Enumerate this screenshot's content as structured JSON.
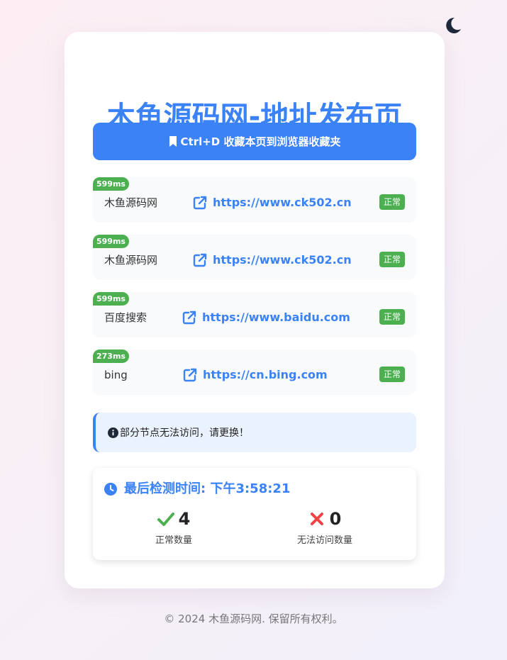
{
  "header": {
    "title": "木鱼源码网-地址发布页"
  },
  "bookmark_button": {
    "label": "Ctrl+D 收藏本页到浏览器收藏夹"
  },
  "links": [
    {
      "latency": "599ms",
      "name": "木鱼源码网",
      "url": "https://www.ck502.cn",
      "status": "正常"
    },
    {
      "latency": "599ms",
      "name": "木鱼源码网",
      "url": "https://www.ck502.cn",
      "status": "正常"
    },
    {
      "latency": "599ms",
      "name": "百度搜索",
      "url": "https://www.baidu.com",
      "status": "正常"
    },
    {
      "latency": "273ms",
      "name": "bing",
      "url": "https://cn.bing.com",
      "status": "正常"
    }
  ],
  "notice": {
    "text": "部分节点无法访问，请更换！"
  },
  "check": {
    "title": "最后检测时间: 下午3:58:21",
    "ok_count": "4",
    "ok_label": "正常数量",
    "fail_count": "0",
    "fail_label": "无法访问数量"
  },
  "footer": {
    "text": "© 2024 木鱼源码网. 保留所有权利。"
  },
  "colors": {
    "accent": "#3b82f6",
    "success": "#4caf50",
    "danger": "#ef4444",
    "moon": "#1e293b"
  },
  "icons": {
    "theme": "moon-icon",
    "bookmark": "bookmark-icon",
    "link": "external-link-icon",
    "notice": "info-circle-icon",
    "clock": "clock-icon",
    "ok": "check-icon",
    "fail": "x-icon"
  }
}
